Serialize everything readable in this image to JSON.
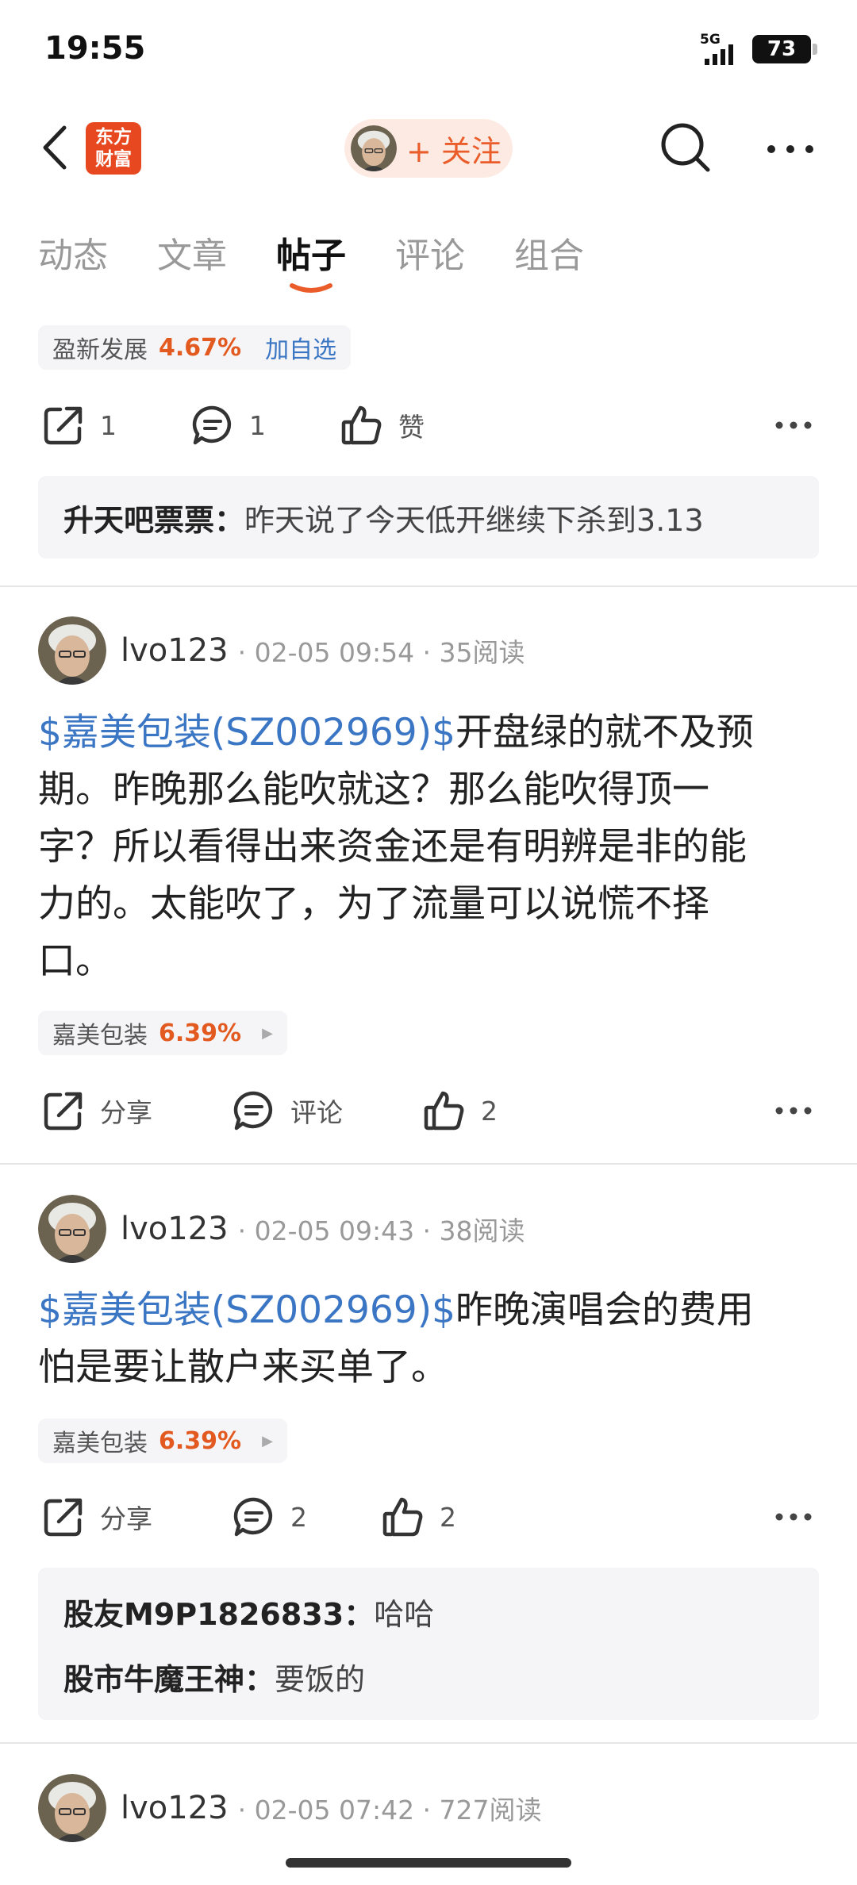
{
  "status_bar": {
    "time": "19:55",
    "network": "5G",
    "battery": "73"
  },
  "nav": {
    "logo_line1": "东方",
    "logo_line2": "财富",
    "follow_label": "+ 关注"
  },
  "tabs": [
    "动态",
    "文章",
    "帖子",
    "评论",
    "组合"
  ],
  "active_tab": "帖子",
  "colors": {
    "accent": "#ea5c2a",
    "link": "#3a76c4",
    "up": "#e35a21",
    "tag_bg": "#f5f5f7"
  },
  "post0": {
    "stock_tag": {
      "name": "盈新发展",
      "change": "4.67%",
      "watch": "加自选"
    },
    "actions": {
      "share": "1",
      "comment": "1",
      "like": "赞"
    },
    "reply": {
      "user": "升天吧票票：",
      "text": "昨天说了今天低开继续下杀到3.13"
    }
  },
  "post1": {
    "author": "lvo123",
    "meta": "· 02-05 09:54 · 35阅读",
    "stock_link": "$嘉美包装(SZ002969)$",
    "text_line1": "开盘绿的就不及预",
    "text_line2": "期。昨晚那么能吹就这？那么能吹得顶一",
    "text_line3": "字？所以看得出来资金还是有明辨是非的能",
    "text_line4": "力的。太能吹了，为了流量可以说慌不择",
    "text_line5": "口。",
    "stock_tag": {
      "name": "嘉美包装",
      "change": "6.39%"
    },
    "actions": {
      "share": "分享",
      "comment": "评论",
      "like": "2"
    }
  },
  "post2": {
    "author": "lvo123",
    "meta": "· 02-05 09:43 · 38阅读",
    "stock_link": "$嘉美包装(SZ002969)$",
    "text_line1": "昨晚演唱会的费用",
    "text_line2": "怕是要让散户来买单了。",
    "stock_tag": {
      "name": "嘉美包装",
      "change": "6.39%"
    },
    "actions": {
      "share": "分享",
      "comment": "2",
      "like": "2"
    },
    "replies": [
      {
        "user": "股友M9P1826833：",
        "text": "哈哈"
      },
      {
        "user": "股市牛魔王神：",
        "text": "要饭的"
      }
    ]
  },
  "post3": {
    "author": "lvo123",
    "meta": "· 02-05 07:42 · 727阅读"
  }
}
